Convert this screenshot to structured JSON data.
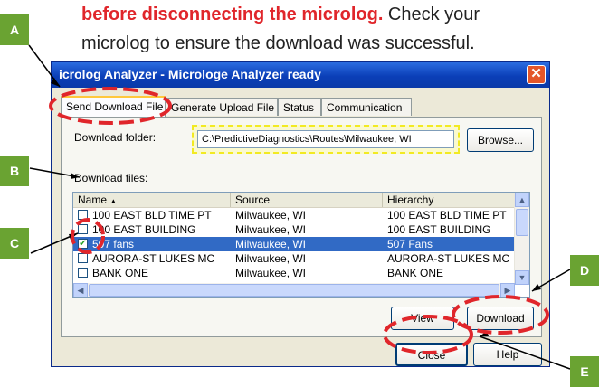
{
  "instruction": {
    "bold_red": "before disconnecting the microlog.",
    "line1_rest": " Check your",
    "line2": "microlog to ensure the download was successful."
  },
  "window": {
    "title": "Microloge Analyzer - Microloge Analyzer ready",
    "title_display": "icrolog Analyzer - Microloge Analyzer ready"
  },
  "tabs": [
    "Send Download File",
    "Generate Upload File",
    "Status",
    "Communication"
  ],
  "download_folder": {
    "label": "Download folder:",
    "value": "C:\\PredictiveDiagnostics\\Routes\\Milwaukee, WI",
    "browse_label": "Browse..."
  },
  "download_files": {
    "label": "Download files:",
    "columns": [
      "Name",
      "Source",
      "Hierarchy"
    ],
    "rows": [
      {
        "name": "100 EAST BLD TIME PT",
        "source": "Milwaukee, WI",
        "hierarchy": "100 EAST BLD TIME PT",
        "checked": false,
        "selected": false
      },
      {
        "name": "100 EAST BUILDING",
        "source": "Milwaukee, WI",
        "hierarchy": "100 EAST BUILDING",
        "checked": false,
        "selected": false
      },
      {
        "name": "507 fans",
        "source": "Milwaukee, WI",
        "hierarchy": "507 Fans",
        "checked": true,
        "selected": true
      },
      {
        "name": "AURORA-ST LUKES MC",
        "source": "Milwaukee, WI",
        "hierarchy": "AURORA-ST LUKES MC",
        "checked": false,
        "selected": false
      },
      {
        "name": "BANK ONE",
        "source": "Milwaukee, WI",
        "hierarchy": "BANK ONE",
        "checked": false,
        "selected": false
      }
    ]
  },
  "buttons": {
    "view": "View",
    "download": "Download",
    "close": "Close",
    "help": "Help"
  },
  "callouts": [
    "A",
    "B",
    "C",
    "D",
    "E"
  ],
  "colors": {
    "callout": "#6aa332",
    "highlight_ring": "#e0262b",
    "folder_highlight": "#f2ea22",
    "selection": "#316ac5"
  }
}
